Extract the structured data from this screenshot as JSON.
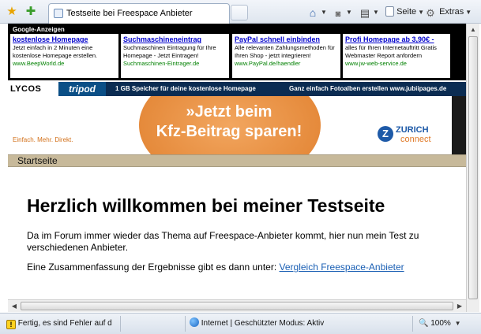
{
  "browser": {
    "tab_title": "Testseite bei Freespace Anbieter",
    "commands": {
      "page": "Seite",
      "extras": "Extras"
    },
    "icons": {
      "favorites_star": "★",
      "add_favorite": "✚",
      "home": "⌂",
      "feeds": "◙",
      "print": "▤"
    }
  },
  "google_ads": {
    "label": "Google-Anzeigen",
    "ads": [
      {
        "title": "kostenlose Homepage",
        "text": "Jetzt einfach in 2 Minuten eine kostenlose Homepage erstellen.",
        "url": "www.BeepWorld.de"
      },
      {
        "title": "Suchmaschineneintrag",
        "text": "Suchmaschinen Eintragung für Ihre Homepage - Jetzt Eintragen!",
        "url": "Suchmaschinen-Eintrager.de"
      },
      {
        "title": "PayPal schnell einbinden",
        "text": "Alle relevanten Zahlungsmethoden für Ihren Shop - jetzt integrieren!",
        "url": "www.PayPal.de/haendler"
      },
      {
        "title": "Profi Homepage ab 3,90€ -",
        "text": "alles für Ihren Internetauftritt Gratis Webmaster Report anfordern",
        "url": "www.jw-web-service.de"
      }
    ]
  },
  "lycos_bar": {
    "logo": "LYCOS",
    "tripod": "tripod",
    "link1": "1 GB Speicher für deine kostenlose Homepage",
    "link2": "Ganz einfach Fotoalben erstellen www.jubiipages.de"
  },
  "banner": {
    "headline_line1": "»Jetzt beim",
    "headline_line2": "Kfz-Beitrag sparen!",
    "tagline": "Einfach. Mehr. Direkt.",
    "brand_mark": "Z",
    "brand_name": "ZURICH",
    "brand_sub": "connect"
  },
  "nav": {
    "home": "Startseite"
  },
  "content": {
    "heading": "Herzlich willkommen bei meiner Testseite",
    "paragraph1": "Da im Forum immer wieder das Thema auf Freespace-Anbieter kommt, hier nun mein Test zu verschiedenen Anbieter.",
    "paragraph2_prefix": "Eine Zusammenfassung der Ergebnisse gibt es dann unter: ",
    "link": "Vergleich Freespace-Anbieter"
  },
  "status_bar": {
    "message": "Fertig, es sind Fehler auf d",
    "zone": "Internet | Geschützter Modus: Aktiv",
    "zoom": "100%"
  }
}
